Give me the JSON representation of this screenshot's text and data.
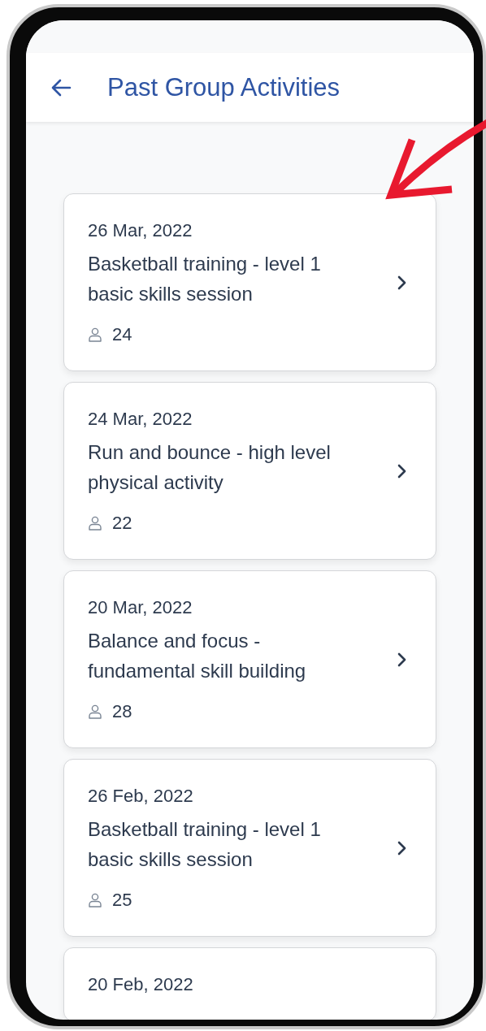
{
  "header": {
    "title": "Past Group Activities"
  },
  "activities": [
    {
      "date": "26 Mar, 2022",
      "title": "Basketball training - level 1 basic skills session",
      "participants": "24"
    },
    {
      "date": "24 Mar, 2022",
      "title": "Run and bounce - high level physical activity",
      "participants": "22"
    },
    {
      "date": "20 Mar, 2022",
      "title": "Balance and focus - fundamental skill building",
      "participants": "28"
    },
    {
      "date": "26 Feb, 2022",
      "title": "Basketball training - level 1 basic skills session",
      "participants": "25"
    },
    {
      "date": "20 Feb, 2022"
    }
  ]
}
